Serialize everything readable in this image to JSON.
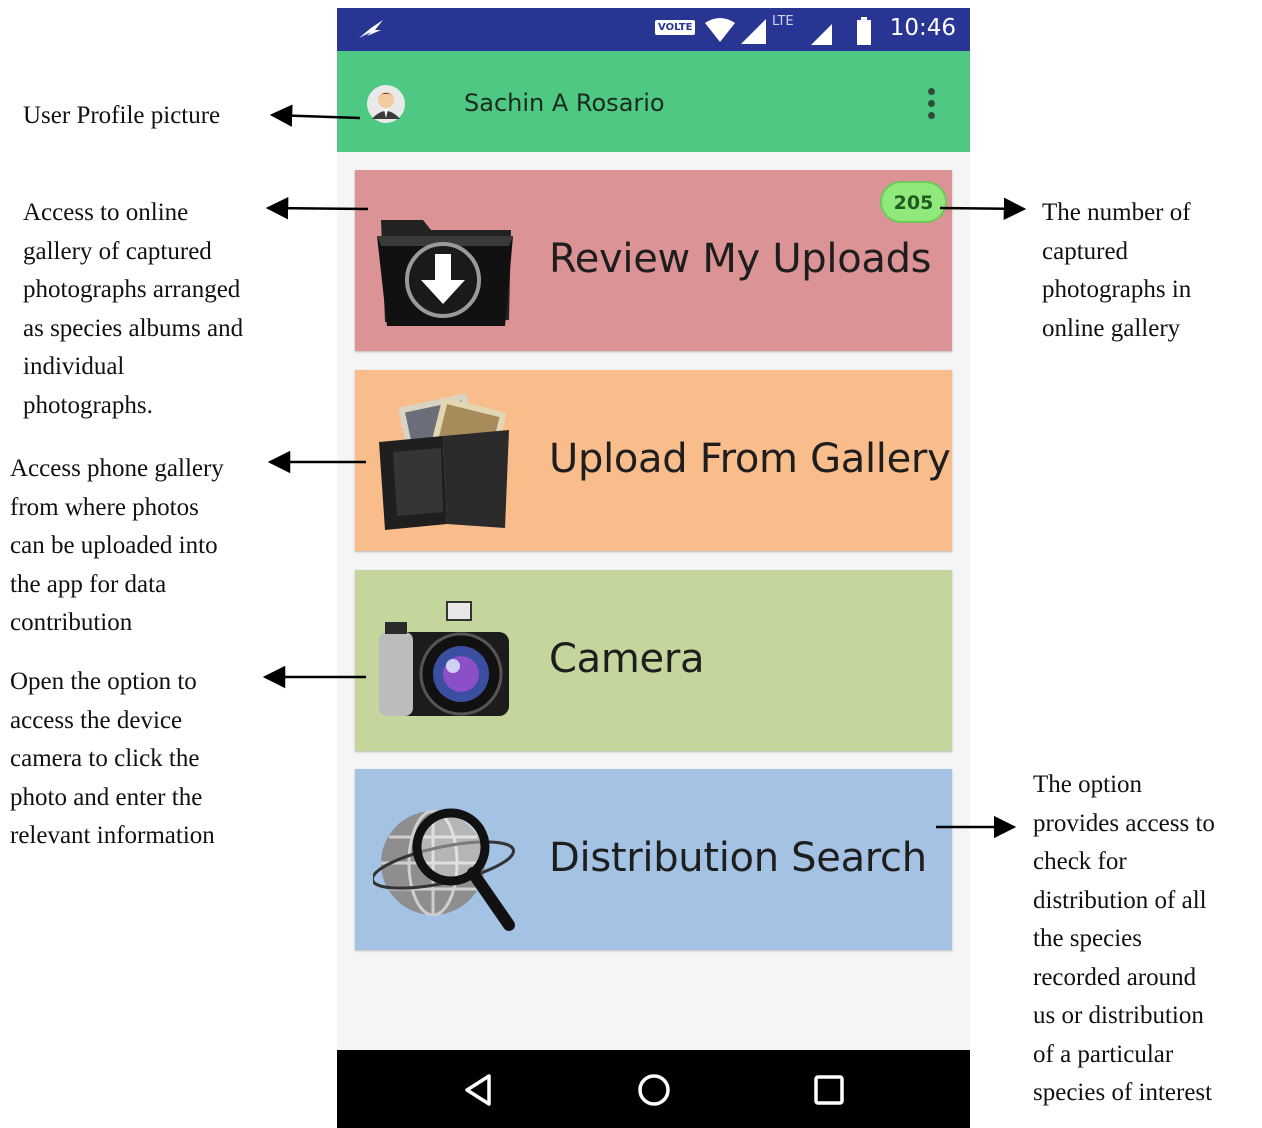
{
  "status_bar": {
    "time": "10:46",
    "volte": "VOLTE",
    "network": "LTE"
  },
  "app_bar": {
    "user_name": "Sachin A Rosario"
  },
  "cards": [
    {
      "label": "Review My Uploads",
      "color": "#dc9395",
      "icon": "download-folder-icon",
      "badge": "205"
    },
    {
      "label": "Upload From Gallery",
      "color": "#f9bc8b",
      "icon": "photo-folder-icon"
    },
    {
      "label": "Camera",
      "color": "#c4d69b",
      "icon": "camera-icon"
    },
    {
      "label": "Distribution Search",
      "color": "#a4c2e4",
      "icon": "globe-magnifier-icon"
    }
  ],
  "nav_bar": {
    "icons": [
      "back-icon",
      "home-icon",
      "recents-icon"
    ]
  },
  "annotations": {
    "profile": "User Profile picture",
    "uploads": "Access to online\ngallery of captured\nphotographs arranged\nas species albums and\nindividual\nphotographs.",
    "gallery": "Access phone gallery\nfrom where photos\ncan be uploaded into\nthe app for data\ncontribution",
    "camera": "Open the option to\naccess the device\ncamera to click the\nphoto and enter the\nrelevant information",
    "count": "The number of\ncaptured\nphotographs in\nonline gallery",
    "distribution": "The option\nprovides access to\ncheck for\ndistribution of all\nthe species\nrecorded around\nus or distribution\nof a particular\nspecies of interest"
  }
}
